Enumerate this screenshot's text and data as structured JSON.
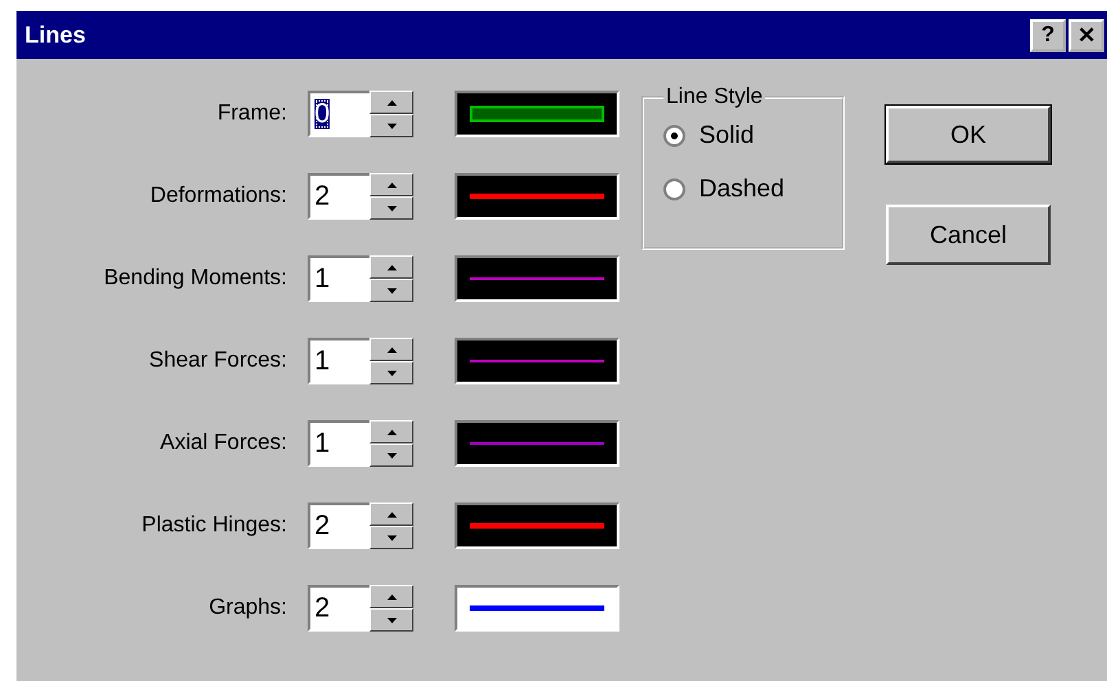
{
  "window": {
    "title": "Lines",
    "help_button": "?",
    "close_button": "✕"
  },
  "rows": [
    {
      "label": "Frame:",
      "value": "0",
      "focused": true,
      "color": "#00c000",
      "kind": "dark"
    },
    {
      "label": "Deformations:",
      "value": "2",
      "focused": false,
      "color": "#ff0000",
      "kind": "dark"
    },
    {
      "label": "Bending Moments:",
      "value": "1",
      "focused": false,
      "color": "#c000c0",
      "kind": "dark"
    },
    {
      "label": "Shear Forces:",
      "value": "1",
      "focused": false,
      "color": "#c000c0",
      "kind": "dark"
    },
    {
      "label": "Axial Forces:",
      "value": "1",
      "focused": false,
      "color": "#a000c0",
      "kind": "dark"
    },
    {
      "label": "Plastic Hinges:",
      "value": "2",
      "focused": false,
      "color": "#ff0000",
      "kind": "dark"
    },
    {
      "label": "Graphs:",
      "value": "2",
      "focused": false,
      "color": "#0000ff",
      "kind": "light"
    }
  ],
  "line_style": {
    "title": "Line Style",
    "options": [
      {
        "label": "Solid",
        "selected": true
      },
      {
        "label": "Dashed",
        "selected": false
      }
    ]
  },
  "buttons": [
    "OK",
    "Cancel"
  ]
}
